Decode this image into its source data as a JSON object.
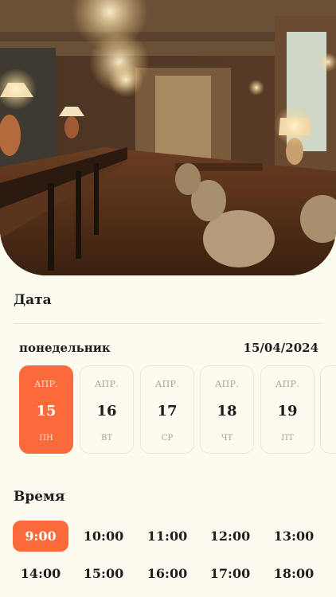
{
  "hero": {
    "image": "restaurant-interior-photo"
  },
  "date_section": {
    "title": "Дата",
    "weekday": "понедельник",
    "date": "15/04/2024",
    "days": [
      {
        "month": "АПР.",
        "day": "15",
        "weekday": "ПН",
        "selected": true
      },
      {
        "month": "АПР.",
        "day": "16",
        "weekday": "ВТ",
        "selected": false
      },
      {
        "month": "АПР.",
        "day": "17",
        "weekday": "СР",
        "selected": false
      },
      {
        "month": "АПР.",
        "day": "18",
        "weekday": "ЧТ",
        "selected": false
      },
      {
        "month": "АПР.",
        "day": "19",
        "weekday": "ПТ",
        "selected": false
      }
    ]
  },
  "time_section": {
    "title": "Время",
    "slots": [
      "9:00",
      "10:00",
      "11:00",
      "12:00",
      "13:00",
      "14:00",
      "15:00",
      "16:00",
      "17:00",
      "18:00"
    ],
    "selected": "9:00"
  },
  "colors": {
    "accent": "#fb6a3a",
    "background": "#fdfaef"
  }
}
